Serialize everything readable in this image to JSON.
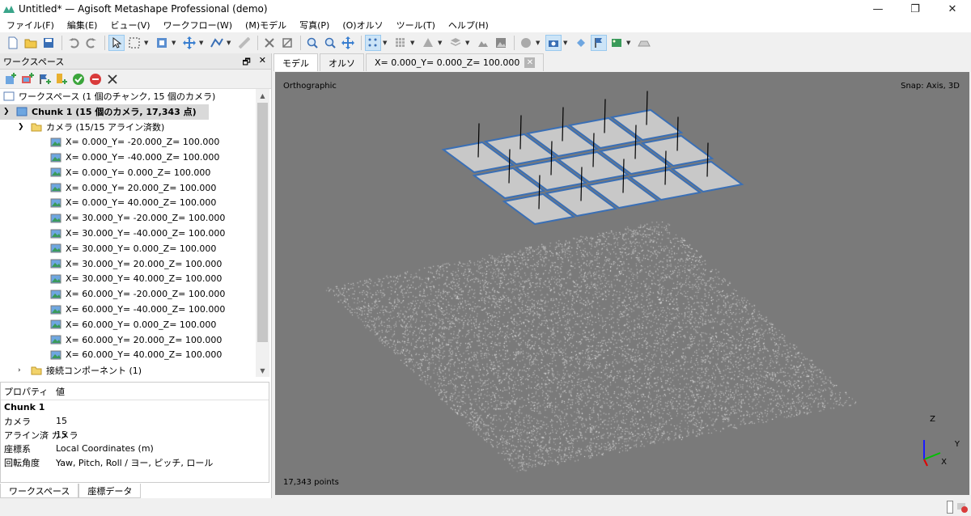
{
  "window": {
    "title": "Untitled* — Agisoft Metashape Professional (demo)",
    "minimize": "—",
    "maximize": "❐",
    "close": "✕"
  },
  "menu": [
    "ファイル(F)",
    "編集(E)",
    "ビュー(V)",
    "ワークフロー(W)",
    "(M)モデル",
    "写真(P)",
    "(O)オルソ",
    "ツール(T)",
    "ヘルプ(H)"
  ],
  "workspace_panel": {
    "title": "ワークスペース",
    "float_icon": "🗗",
    "close_icon": "✕",
    "tree": {
      "root": "ワークスペース (1 個のチャンク, 15 個のカメラ)",
      "chunk": "Chunk 1 (15 個のカメラ, 17,343 点)",
      "cameras_folder": "カメラ (15/15 アライン済数)",
      "cameras": [
        "X=   0.000_Y=  -20.000_Z= 100.000",
        "X=   0.000_Y=  -40.000_Z= 100.000",
        "X=   0.000_Y=   0.000_Z= 100.000",
        "X=   0.000_Y=  20.000_Z= 100.000",
        "X=   0.000_Y=  40.000_Z= 100.000",
        "X=  30.000_Y=  -20.000_Z= 100.000",
        "X=  30.000_Y=  -40.000_Z= 100.000",
        "X=  30.000_Y=   0.000_Z= 100.000",
        "X=  30.000_Y=  20.000_Z= 100.000",
        "X=  30.000_Y=  40.000_Z= 100.000",
        "X=  60.000_Y=  -20.000_Z= 100.000",
        "X=  60.000_Y=  -40.000_Z= 100.000",
        "X=  60.000_Y=   0.000_Z= 100.000",
        "X=  60.000_Y=  20.000_Z= 100.000",
        "X=  60.000_Y=  40.000_Z= 100.000"
      ],
      "components_folder": "接続コンポーネント (1)"
    }
  },
  "properties": {
    "col_property": "プロパティ",
    "col_value": "値",
    "section": "Chunk 1",
    "rows": [
      {
        "key": "カメラ",
        "value": "15"
      },
      {
        "key": "アライン済 カメラ",
        "value": "15"
      },
      {
        "key": "座標系",
        "value": "Local Coordinates (m)"
      },
      {
        "key": "回転角度",
        "value": "Yaw, Pitch, Roll / ヨー, ピッチ, ロール"
      }
    ]
  },
  "bottom_tabs": [
    "ワークスペース",
    "座標データ"
  ],
  "view_tabs": {
    "model": "モデル",
    "ortho": "オルソ",
    "photo": "X=   0.000_Y=   0.000_Z= 100.000",
    "photo_close": "✕"
  },
  "viewport": {
    "projection": "Orthographic",
    "snap": "Snap: Axis, 3D",
    "points": "17,343 points",
    "axis_z": "Z",
    "axis_y": "Y",
    "axis_x": "X",
    "colors": {
      "background": "#7a7a7a",
      "camera_fill": "#c8c8c8",
      "camera_border": "#3a6fb5",
      "points": "#ffffff"
    }
  }
}
